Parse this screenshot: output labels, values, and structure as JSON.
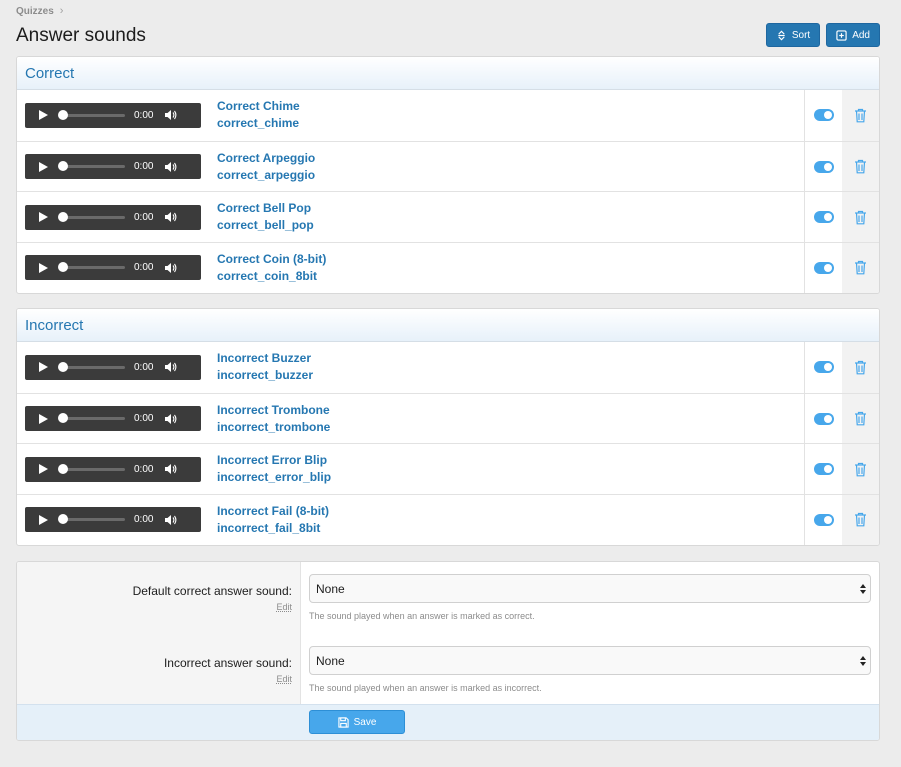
{
  "breadcrumb": {
    "items": [
      "Quizzes"
    ]
  },
  "page": {
    "title": "Answer sounds"
  },
  "toolbar": {
    "sort_label": "Sort",
    "add_label": "Add"
  },
  "colors": {
    "accent": "#2577b1",
    "toggle_on": "#47a7eb",
    "player_bg": "#3b3b3b"
  },
  "groups": [
    {
      "title": "Correct",
      "sounds": [
        {
          "title": "Correct Chime",
          "key": "correct_chime",
          "time": "0:00",
          "enabled": true
        },
        {
          "title": "Correct Arpeggio",
          "key": "correct_arpeggio",
          "time": "0:00",
          "enabled": true
        },
        {
          "title": "Correct Bell Pop",
          "key": "correct_bell_pop",
          "time": "0:00",
          "enabled": true
        },
        {
          "title": "Correct Coin (8-bit)",
          "key": "correct_coin_8bit",
          "time": "0:00",
          "enabled": true
        }
      ]
    },
    {
      "title": "Incorrect",
      "sounds": [
        {
          "title": "Incorrect Buzzer",
          "key": "incorrect_buzzer",
          "time": "0:00",
          "enabled": true
        },
        {
          "title": "Incorrect Trombone",
          "key": "incorrect_trombone",
          "time": "0:00",
          "enabled": true
        },
        {
          "title": "Incorrect Error Blip",
          "key": "incorrect_error_blip",
          "time": "0:00",
          "enabled": true
        },
        {
          "title": "Incorrect Fail (8-bit)",
          "key": "incorrect_fail_8bit",
          "time": "0:00",
          "enabled": true
        }
      ]
    }
  ],
  "options": {
    "correct": {
      "label": "Default correct answer sound:",
      "edit": "Edit",
      "value": "None",
      "hint": "The sound played when an answer is marked as correct."
    },
    "incorrect": {
      "label": "Incorrect answer sound:",
      "edit": "Edit",
      "value": "None",
      "hint": "The sound played when an answer is marked as incorrect."
    },
    "save_label": "Save"
  },
  "icons": {
    "sort": "sort-icon",
    "add": "add-icon",
    "play": "play-icon",
    "volume": "volume-icon",
    "delete": "trash-icon",
    "save": "save-icon"
  }
}
